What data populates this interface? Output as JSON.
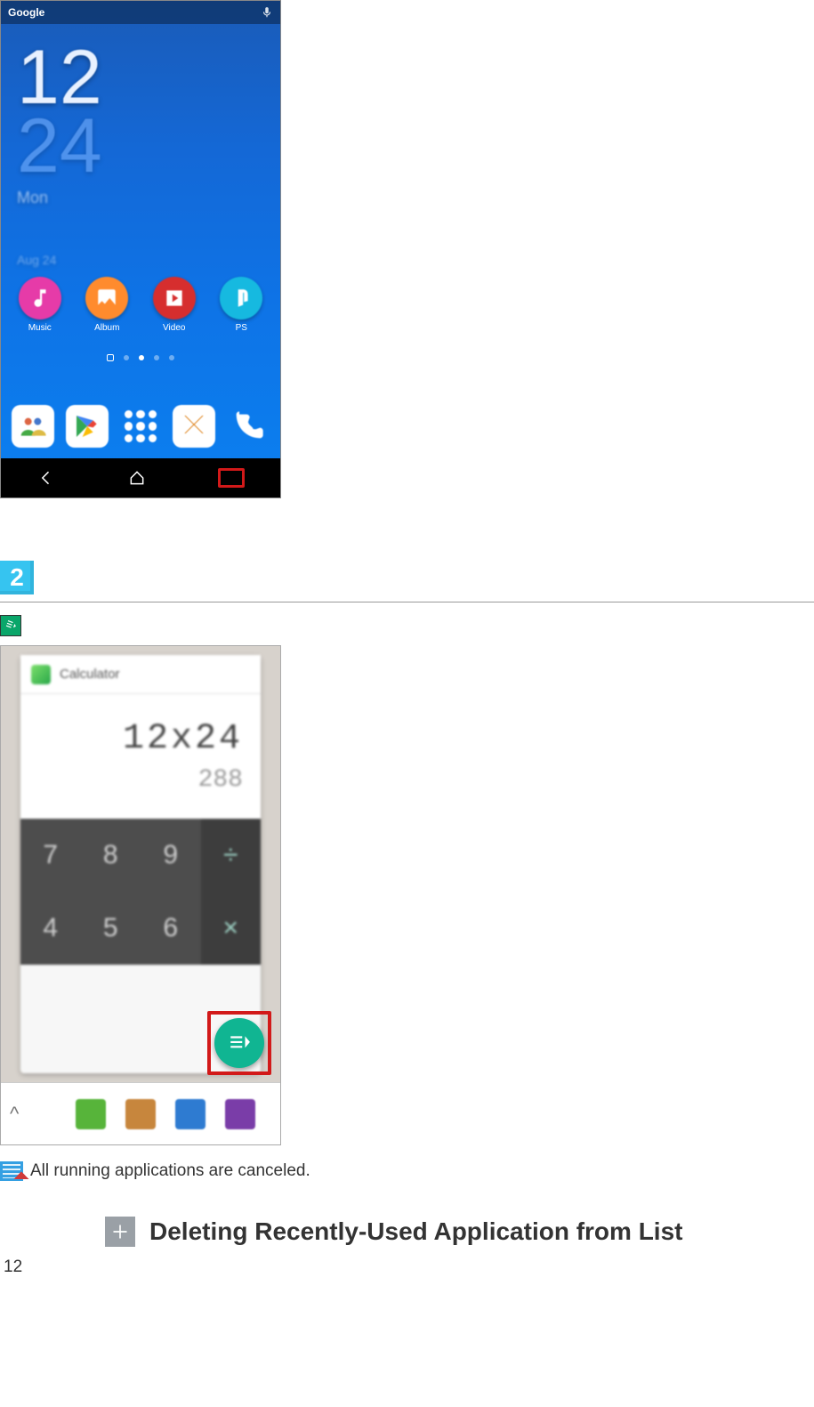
{
  "screenshot1": {
    "statusbar_left": "Google",
    "statusbar_right_icon": "microphone",
    "clock_hour": "12",
    "clock_min": "24",
    "clock_day": "Mon",
    "clock_date": "Aug 24",
    "media_row": [
      {
        "label": "Music",
        "icon": "music"
      },
      {
        "label": "Album",
        "icon": "album"
      },
      {
        "label": "Video",
        "icon": "video"
      },
      {
        "label": "PS",
        "icon": "ps"
      }
    ],
    "dock_icons": [
      "contacts",
      "play-store",
      "apps",
      "mail",
      "phone"
    ],
    "nav_icons": [
      "back",
      "home",
      "recent"
    ],
    "highlighted_nav": "recent"
  },
  "step_number": "2",
  "closeall_chip_icon": "close-all",
  "screenshot2": {
    "card_app_title": "Calculator",
    "calc_line1": "12x24",
    "calc_line2": "288",
    "keypad": [
      "7",
      "8",
      "9",
      "÷",
      "4",
      "5",
      "6",
      "×"
    ],
    "floating_button": "close-all",
    "smallapps_caret": "^",
    "smallapps": [
      "green",
      "orange",
      "blue",
      "purple"
    ]
  },
  "bullet_text": "All running applications are canceled.",
  "section_title": "Deleting Recently-Used Application from List",
  "page_number": "12"
}
